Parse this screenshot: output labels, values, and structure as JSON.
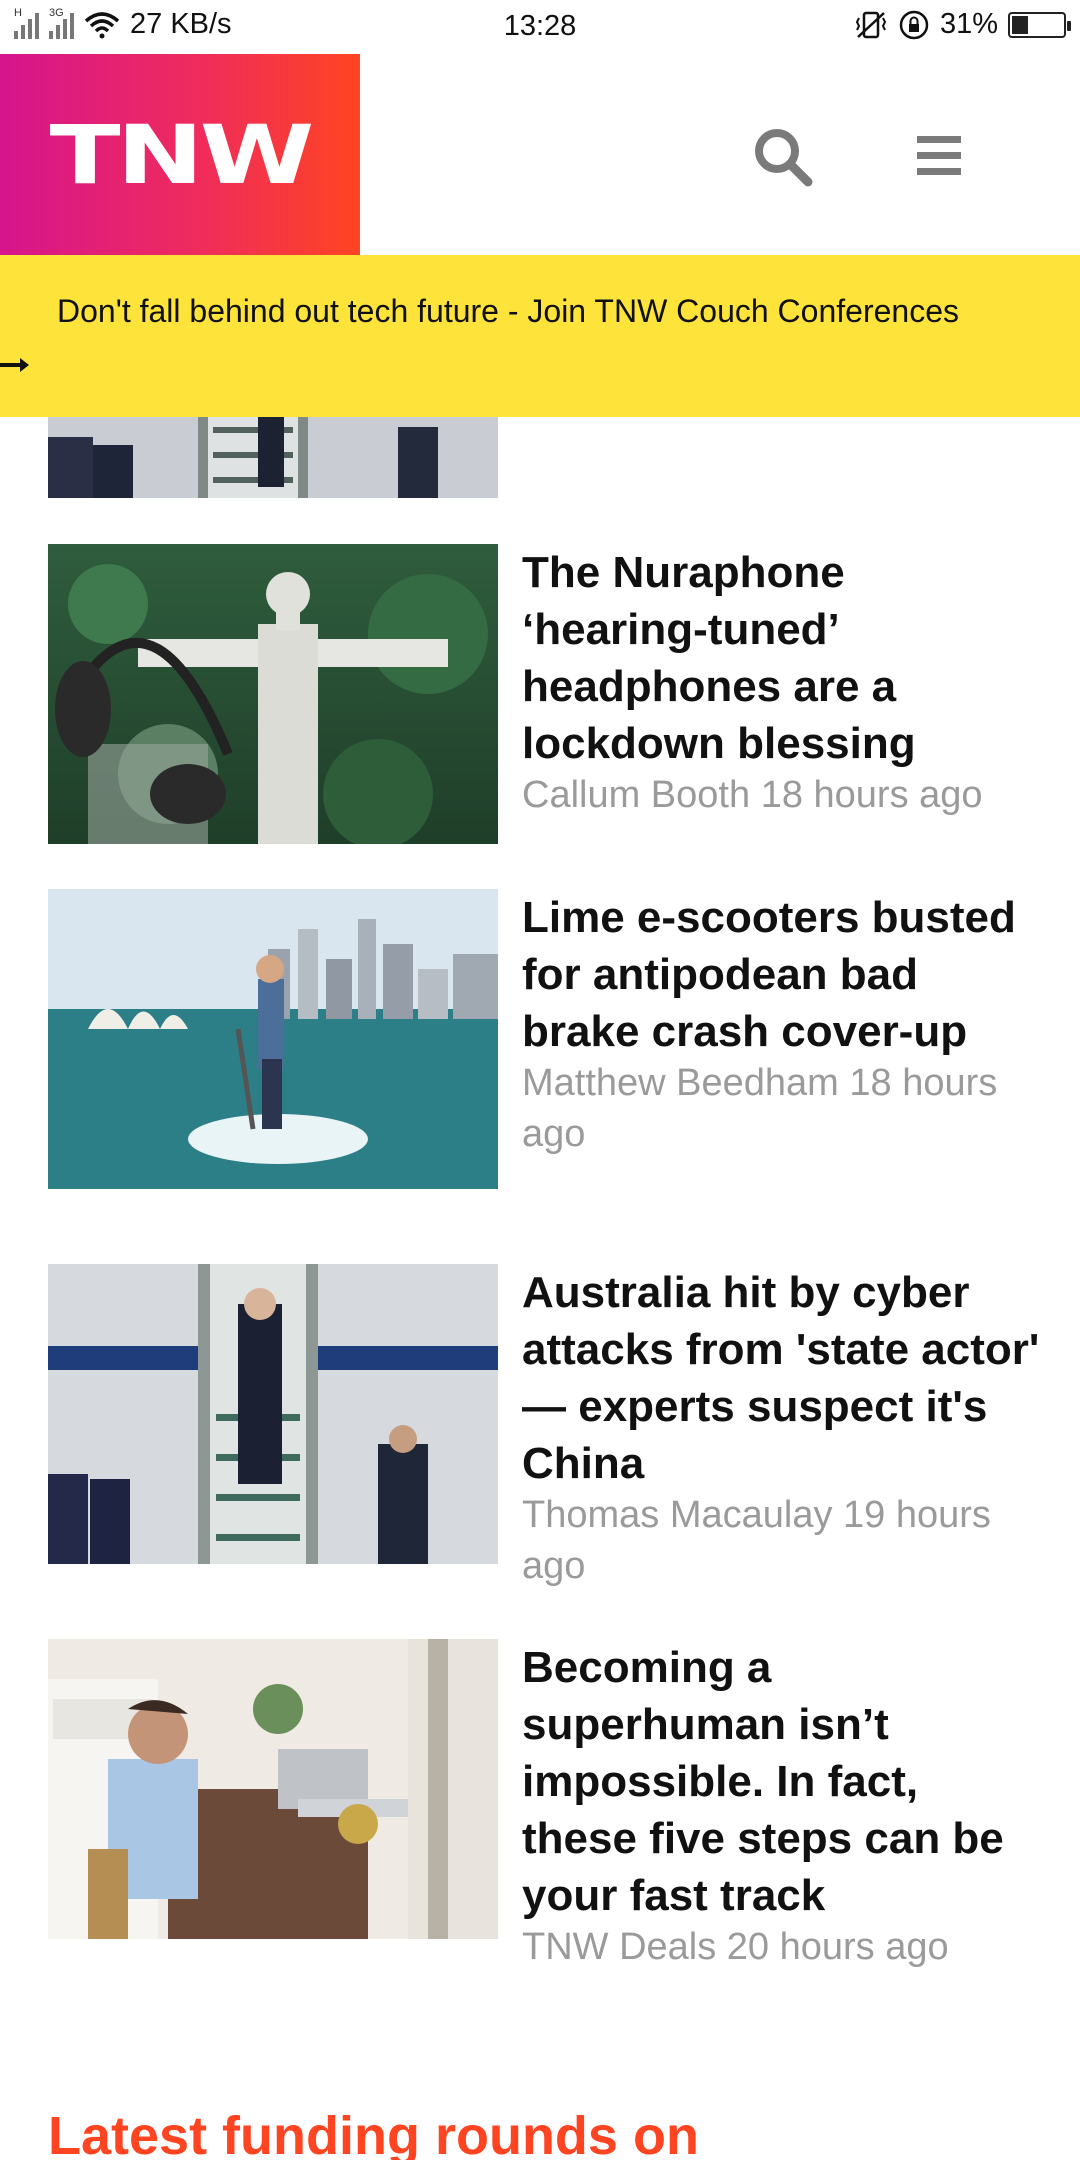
{
  "status_bar": {
    "network_label_1": "H",
    "network_label_2": "3G",
    "speed": "27 KB/s",
    "time": "13:28",
    "battery": "31%",
    "battery_level": 0.31
  },
  "header": {
    "logo": "TNW",
    "search_icon": "search-icon",
    "menu_icon": "hamburger-menu-icon"
  },
  "banner": {
    "text": "Don't fall behind out tech future - Join TNW Couch Conferences"
  },
  "articles": [
    {
      "title": "The Nuraphone ‘hearing-tuned’ headphones are a lockdown blessing",
      "author": "Callum Booth",
      "time": "18 hours ago"
    },
    {
      "title": "Lime e-scooters busted for antipodean bad brake crash cover-up",
      "author": "Matthew Beedham",
      "time": "18 hours ago"
    },
    {
      "title": "Australia hit by cyber attacks from 'state actor' — experts suspect it's China",
      "author": "Thomas Macaulay",
      "time": "19 hours ago"
    },
    {
      "title": "Becoming a superhuman isn’t impossible. In fact, these five steps can be your fast track",
      "author": "TNW Deals",
      "time": "20 hours ago"
    }
  ],
  "section": {
    "heading": "Latest funding rounds on"
  },
  "colors": {
    "brand_gradient_start": "#d6148d",
    "brand_gradient_end": "#ff4422",
    "banner": "#fde33a",
    "meta_text": "#9a9a9a",
    "section_heading": "#ff4422"
  }
}
